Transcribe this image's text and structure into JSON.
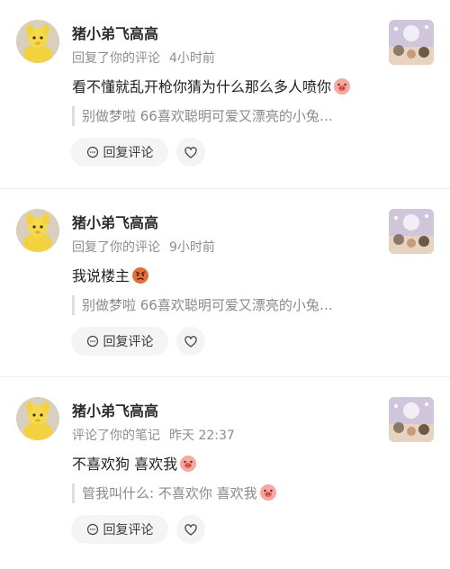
{
  "notifications": [
    {
      "username": "猪小弟飞高高",
      "action": "回复了你的评论",
      "time": "4小时前",
      "comment": "看不懂就乱开枪你猜为什么那么多人喷你",
      "comment_emoji": "pig-laugh-emoji",
      "quote": "别做梦啦 66喜欢聪明可爱又漂亮的小兔…",
      "quote_emoji": "",
      "reply_label": "回复评论"
    },
    {
      "username": "猪小弟飞高高",
      "action": "回复了你的评论",
      "time": "9小时前",
      "comment": "我说楼主",
      "comment_emoji": "angry-face-emoji",
      "quote": "别做梦啦 66喜欢聪明可爱又漂亮的小兔…",
      "quote_emoji": "",
      "reply_label": "回复评论"
    },
    {
      "username": "猪小弟飞高高",
      "action": "评论了你的笔记",
      "time": "昨天 22:37",
      "comment": "不喜欢狗 喜欢我",
      "comment_emoji": "pig-laugh-emoji",
      "quote": "管我叫什么: 不喜欢你 喜欢我",
      "quote_emoji": "pig-laugh-emoji",
      "reply_label": "回复评论"
    }
  ],
  "colors": {
    "meta_text": "#8d8d8d",
    "button_bg": "#f4f4f4",
    "divider": "#ececec"
  }
}
